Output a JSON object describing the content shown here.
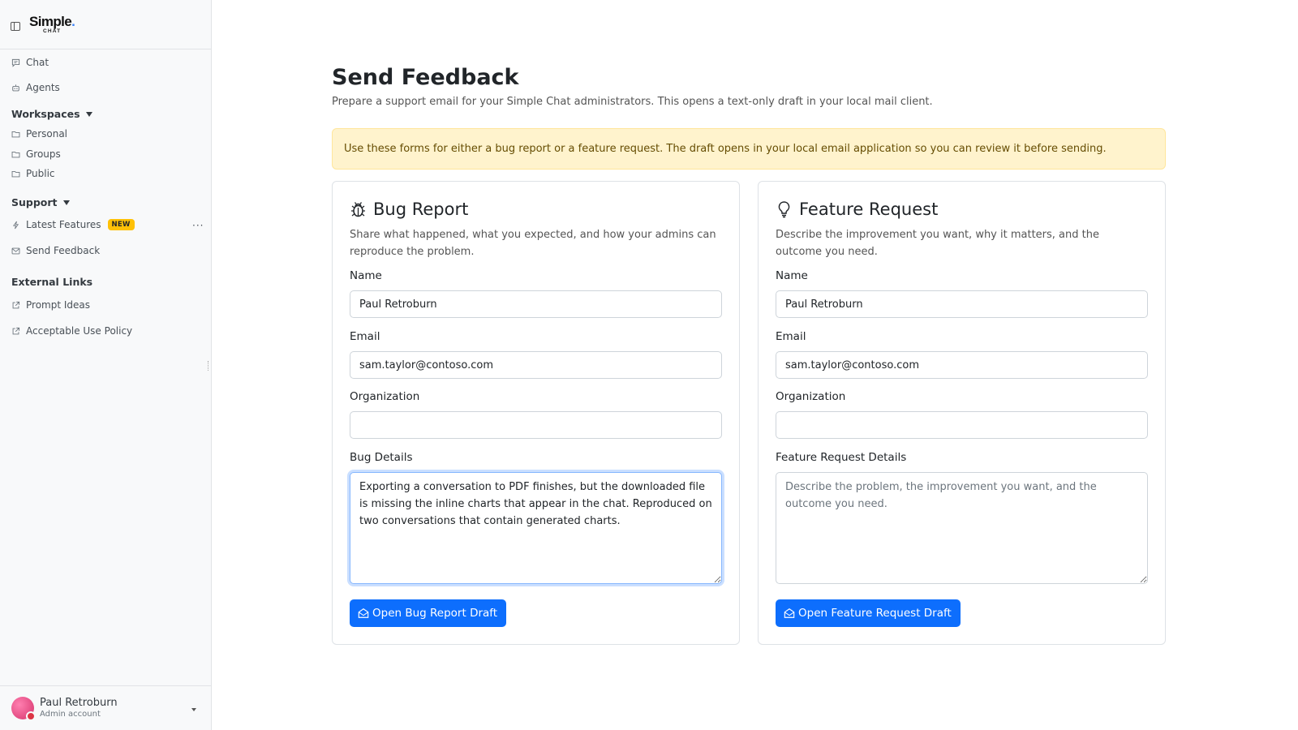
{
  "brand": {
    "name": "Simple",
    "name_suffix": ".",
    "sub": "CHAT"
  },
  "sidebar": {
    "chat": "Chat",
    "agents": "Agents",
    "workspaces": {
      "heading": "Workspaces",
      "items": [
        "Personal",
        "Groups",
        "Public"
      ]
    },
    "support": {
      "heading": "Support",
      "latest_features": "Latest Features",
      "new_badge": "NEW",
      "send_feedback": "Send Feedback",
      "more": "···"
    },
    "external": {
      "heading": "External Links",
      "items": [
        "Prompt Ideas",
        "Acceptable Use Policy"
      ]
    }
  },
  "user": {
    "name": "Paul Retroburn",
    "role": "Admin account"
  },
  "page": {
    "title": "Send Feedback",
    "description": "Prepare a support email for your Simple Chat administrators. This opens a text-only draft in your local mail client.",
    "alert": "Use these forms for either a bug report or a feature request. The draft opens in your local email application so you can review it before sending."
  },
  "bug": {
    "title": "Bug Report",
    "description": "Share what happened, what you expected, and how your admins can reproduce the problem.",
    "name_label": "Name",
    "name_value": "Paul Retroburn",
    "email_label": "Email",
    "email_value": "sam.taylor@contoso.com",
    "org_label": "Organization",
    "org_value": "",
    "details_label": "Bug Details",
    "details_value": "Exporting a conversation to PDF finishes, but the downloaded file is missing the inline charts that appear in the chat. Reproduced on two conversations that contain generated charts.",
    "button": "Open Bug Report Draft"
  },
  "feature": {
    "title": "Feature Request",
    "description": "Describe the improvement you want, why it matters, and the outcome you need.",
    "name_label": "Name",
    "name_value": "Paul Retroburn",
    "email_label": "Email",
    "email_value": "sam.taylor@contoso.com",
    "org_label": "Organization",
    "org_value": "",
    "details_label": "Feature Request Details",
    "details_placeholder": "Describe the problem, the improvement you want, and the outcome you need.",
    "button": "Open Feature Request Draft"
  },
  "colors": {
    "primary": "#0d6efd",
    "alert_bg": "#fff3cd",
    "alert_text": "#664d03",
    "badge": "#ffc107",
    "sidebar_bg": "#f8f9fa"
  },
  "icons": [
    "sidebar-toggle-icon",
    "chat-icon",
    "robot-icon",
    "folder-icon",
    "lightning-icon",
    "envelope-icon",
    "external-link-icon",
    "bug-icon",
    "lightbulb-icon",
    "envelope-open-icon"
  ]
}
